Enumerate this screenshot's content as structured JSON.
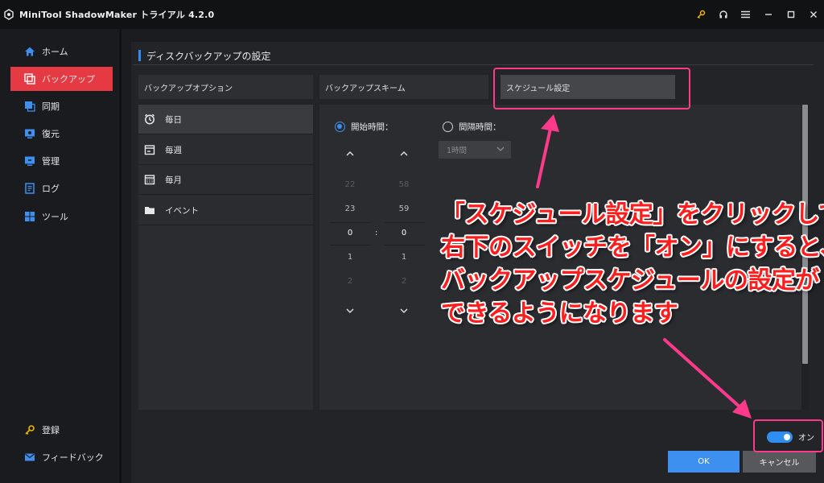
{
  "app": {
    "title": "MiniTool ShadowMaker トライアル 4.2.0"
  },
  "sidebar": {
    "items": [
      {
        "label": "ホーム",
        "icon": "home-icon"
      },
      {
        "label": "バックアップ",
        "icon": "backup-icon",
        "active": true
      },
      {
        "label": "同期",
        "icon": "sync-icon"
      },
      {
        "label": "復元",
        "icon": "restore-icon"
      },
      {
        "label": "管理",
        "icon": "manage-icon"
      },
      {
        "label": "ログ",
        "icon": "log-icon"
      },
      {
        "label": "ツール",
        "icon": "tools-icon"
      }
    ],
    "bottom": [
      {
        "label": "登録",
        "icon": "key-icon"
      },
      {
        "label": "フィードバック",
        "icon": "mail-icon"
      }
    ]
  },
  "page": {
    "heading": "ディスクバックアップの設定",
    "tabs": [
      "バックアップオプション",
      "バックアップスキーム",
      "スケジュール設定"
    ]
  },
  "schedule": {
    "options": [
      {
        "label": "毎日",
        "icon": "clock-icon",
        "selected": true
      },
      {
        "label": "毎週",
        "icon": "calendar-week-icon"
      },
      {
        "label": "毎月",
        "icon": "calendar-month-icon"
      },
      {
        "label": "イベント",
        "icon": "folder-icon"
      }
    ],
    "start_time_label": "開始時間：",
    "interval_label": "間隔時間：",
    "interval_value": "1時間",
    "hours": [
      "22",
      "23",
      "0",
      "1",
      "2"
    ],
    "minutes": [
      "58",
      "59",
      "0",
      "1",
      "2"
    ],
    "colon": ":",
    "switch_label": "オン",
    "switch_on": true
  },
  "buttons": {
    "ok": "OK",
    "cancel": "キャンセル"
  },
  "annotation": {
    "lines": [
      "「スケジュール設定」をクリックして",
      "右下のスイッチを「オン」にすると、",
      "バックアップスケジュールの設定が",
      "できるようになります"
    ]
  },
  "colors": {
    "accent": "#2f8ef0",
    "active_nav": "#e53a43",
    "highlight": "#ff3a8a",
    "annotation_text": "#ff1e1e"
  }
}
